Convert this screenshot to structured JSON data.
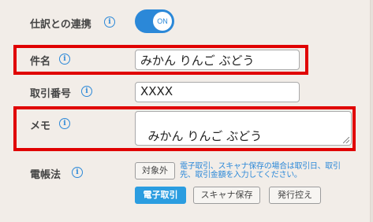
{
  "integration": {
    "label": "仕訳との連携",
    "toggle_text": "ON"
  },
  "subject": {
    "label": "件名",
    "value": "みかん りんご ぶどう"
  },
  "ref_number": {
    "label": "取引番号",
    "value": "XXXX"
  },
  "memo": {
    "label": "メモ",
    "value": "みかん りんご ぶどう"
  },
  "ebook": {
    "label": "電帳法",
    "excluded_label": "対象外",
    "note": "電子取引、スキャナ保存の場合は取引日、取引先、取引金額を入力してください。",
    "options": [
      "電子取引",
      "スキャナ保存",
      "発行控え"
    ],
    "selected": "電子取引"
  },
  "colors": {
    "accent": "#2b88d8",
    "highlight": "#e00000",
    "background": "#f2ede8"
  }
}
